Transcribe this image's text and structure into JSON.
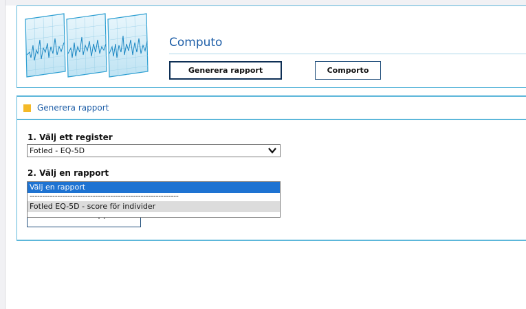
{
  "header": {
    "app_title": "Computo",
    "buttons": {
      "generate_report": "Generera rapport",
      "comporto": "Comporto"
    }
  },
  "panel": {
    "title": "Generera rapport",
    "step1_label": "1. Välj ett register",
    "register_select_value": "Fotled - EQ-5D",
    "step2_label": "2. Välj en rapport",
    "report_dropdown_options": [
      "Välj en rapport",
      "-----------------------------------------------------------",
      "Fotled EQ-5D - score för individer"
    ],
    "selected_option_index": 0,
    "hovered_option_index": 2,
    "generate_button_label": "Generera rapport"
  },
  "colors": {
    "accent_blue": "#5cb7da",
    "title_blue": "#1f5fa8",
    "marker_yellow": "#f4b928",
    "selected_option": "#1e73d2"
  }
}
